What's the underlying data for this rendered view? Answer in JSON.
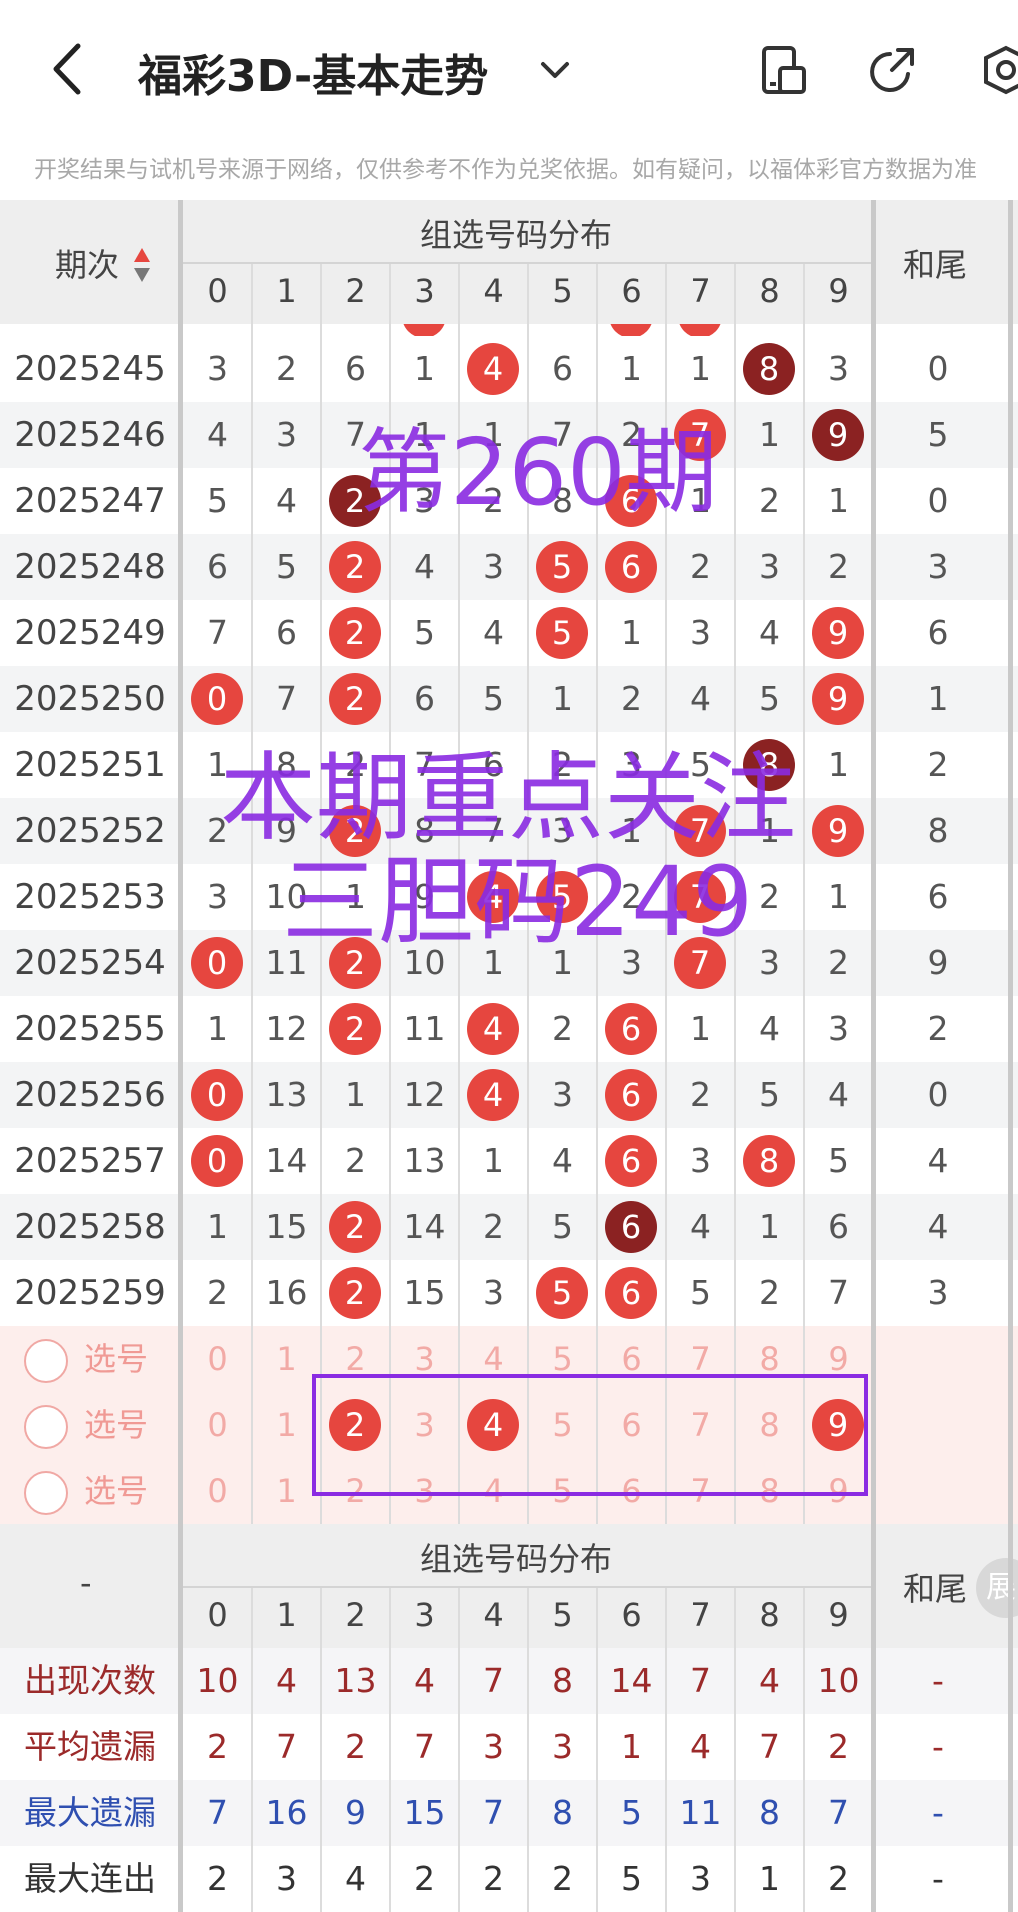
{
  "header": {
    "title": "福彩3D-基本走势",
    "notice": "开奖结果与试机号来源于网络，仅供参考不作为兑奖依据。如有疑问，以福体彩官方数据为准"
  },
  "table_header": {
    "period_col": "期次",
    "group_title": "组选号码分布",
    "digits": [
      "0",
      "1",
      "2",
      "3",
      "4",
      "5",
      "6",
      "7",
      "8",
      "9"
    ],
    "tail_col": "和尾"
  },
  "rows": [
    {
      "period": "2025245",
      "cells": [
        "3",
        "2",
        "6",
        "1",
        "4",
        "6",
        "1",
        "1",
        "8",
        "3"
      ],
      "balls": [
        4,
        8
      ],
      "dark": [
        8
      ],
      "tail": "0"
    },
    {
      "period": "2025246",
      "cells": [
        "4",
        "3",
        "7",
        "1",
        "1",
        "7",
        "2",
        "7",
        "1",
        "9"
      ],
      "balls": [
        7,
        9
      ],
      "dark": [
        9
      ],
      "tail": "5"
    },
    {
      "period": "2025247",
      "cells": [
        "5",
        "4",
        "2",
        "3",
        "2",
        "8",
        "6",
        "1",
        "2",
        "1"
      ],
      "balls": [
        2,
        6
      ],
      "dark": [
        2
      ],
      "tail": "0"
    },
    {
      "period": "2025248",
      "cells": [
        "6",
        "5",
        "2",
        "4",
        "3",
        "5",
        "6",
        "2",
        "3",
        "2"
      ],
      "balls": [
        2,
        5,
        6
      ],
      "dark": [],
      "tail": "3"
    },
    {
      "period": "2025249",
      "cells": [
        "7",
        "6",
        "2",
        "5",
        "4",
        "5",
        "1",
        "3",
        "4",
        "9"
      ],
      "balls": [
        2,
        5,
        9
      ],
      "dark": [],
      "tail": "6"
    },
    {
      "period": "2025250",
      "cells": [
        "0",
        "7",
        "2",
        "6",
        "5",
        "1",
        "2",
        "4",
        "5",
        "9"
      ],
      "balls": [
        0,
        2,
        9
      ],
      "dark": [],
      "tail": "1"
    },
    {
      "period": "2025251",
      "cells": [
        "1",
        "8",
        "2",
        "7",
        "6",
        "2",
        "3",
        "5",
        "8",
        "1"
      ],
      "balls": [
        8
      ],
      "dark": [
        8
      ],
      "tail": "2"
    },
    {
      "period": "2025252",
      "cells": [
        "2",
        "9",
        "2",
        "8",
        "7",
        "3",
        "1",
        "7",
        "1",
        "9"
      ],
      "balls": [
        2,
        7,
        9
      ],
      "dark": [],
      "tail": "8"
    },
    {
      "period": "2025253",
      "cells": [
        "3",
        "10",
        "1",
        "9",
        "4",
        "5",
        "2",
        "7",
        "2",
        "1"
      ],
      "balls": [
        4,
        5,
        7
      ],
      "dark": [],
      "tail": "6"
    },
    {
      "period": "2025254",
      "cells": [
        "0",
        "11",
        "2",
        "10",
        "1",
        "1",
        "3",
        "7",
        "3",
        "2"
      ],
      "balls": [
        0,
        2,
        7
      ],
      "dark": [],
      "tail": "9"
    },
    {
      "period": "2025255",
      "cells": [
        "1",
        "12",
        "2",
        "11",
        "4",
        "2",
        "6",
        "1",
        "4",
        "3"
      ],
      "balls": [
        2,
        4,
        6
      ],
      "dark": [],
      "tail": "2"
    },
    {
      "period": "2025256",
      "cells": [
        "0",
        "13",
        "1",
        "12",
        "4",
        "3",
        "6",
        "2",
        "5",
        "4"
      ],
      "balls": [
        0,
        4,
        6
      ],
      "dark": [],
      "tail": "0"
    },
    {
      "period": "2025257",
      "cells": [
        "0",
        "14",
        "2",
        "13",
        "1",
        "4",
        "6",
        "3",
        "8",
        "5"
      ],
      "balls": [
        0,
        6,
        8
      ],
      "dark": [],
      "tail": "4"
    },
    {
      "period": "2025258",
      "cells": [
        "1",
        "15",
        "2",
        "14",
        "2",
        "5",
        "6",
        "4",
        "1",
        "6"
      ],
      "balls": [
        2,
        6
      ],
      "dark": [
        6
      ],
      "tail": "4"
    },
    {
      "period": "2025259",
      "cells": [
        "2",
        "16",
        "2",
        "15",
        "3",
        "5",
        "6",
        "5",
        "2",
        "7"
      ],
      "balls": [
        2,
        5,
        6
      ],
      "dark": [],
      "tail": "3"
    }
  ],
  "select_rows": [
    {
      "label": "选号",
      "picked": []
    },
    {
      "label": "选号",
      "picked": [
        2,
        4,
        9
      ]
    },
    {
      "label": "选号",
      "picked": []
    }
  ],
  "footer_header": {
    "period_col": "-",
    "group_title": "组选号码分布",
    "digits": [
      "0",
      "1",
      "2",
      "3",
      "4",
      "5",
      "6",
      "7",
      "8",
      "9"
    ],
    "tail_col": "和尾",
    "expand_label": "展"
  },
  "stats": [
    {
      "label": "出现次数",
      "values": [
        "10",
        "4",
        "13",
        "4",
        "7",
        "8",
        "14",
        "7",
        "4",
        "10"
      ],
      "tail": "-",
      "color": "#9b2a2a"
    },
    {
      "label": "平均遗漏",
      "values": [
        "2",
        "7",
        "2",
        "7",
        "3",
        "3",
        "1",
        "4",
        "7",
        "2"
      ],
      "tail": "-",
      "color": "#9b2a2a"
    },
    {
      "label": "最大遗漏",
      "values": [
        "7",
        "16",
        "9",
        "15",
        "7",
        "8",
        "5",
        "11",
        "8",
        "7"
      ],
      "tail": "-",
      "color": "#2f4fb0"
    },
    {
      "label": "最大连出",
      "values": [
        "2",
        "3",
        "4",
        "2",
        "2",
        "2",
        "5",
        "3",
        "1",
        "2"
      ],
      "tail": "-",
      "color": "#333333"
    }
  ],
  "overlay": {
    "line1": "第260期",
    "line2": "本期重点关注",
    "line3": "三胆码249"
  }
}
